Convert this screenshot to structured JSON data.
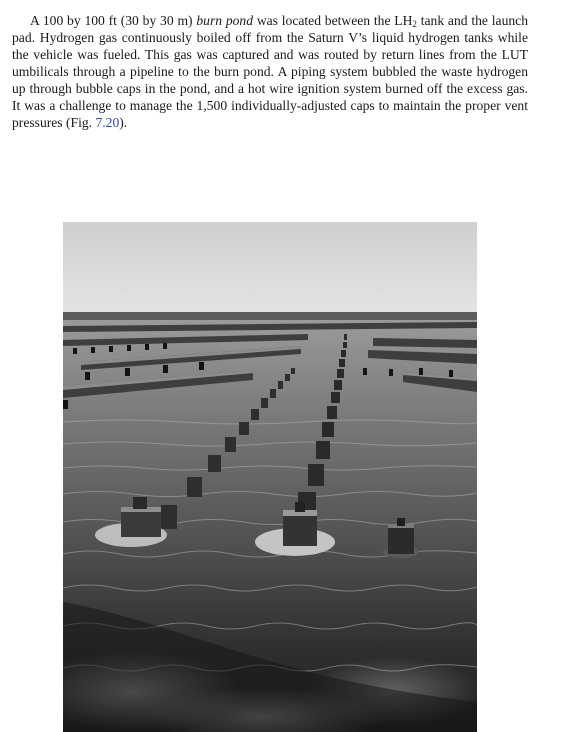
{
  "paragraph": {
    "s1_lead": "A 100 by 100 ft (30 by 30 m) ",
    "s1_term": "burn pond",
    "s1_rest_a": " was located between the LH",
    "s1_sub": "2",
    "s1_rest_b": " tank and the launch pad.",
    "s2": " Hydrogen gas continuously boiled off from the Saturn V’s liquid hydrogen tanks while the vehicle was fueled.",
    "s3": " This gas was captured and was routed by return lines from the LUT umbilicals through a pipeline to the burn pond.",
    "s4": " A piping system bubbled the waste hydrogen up through bubble caps in the pond, and a hot wire ignition system burned off the excess gas.",
    "s5_lead": " It was a challenge to manage the 1,500 individually-adjusted caps to maintain the proper vent pressures (Fig. ",
    "fig_ref": "7.20",
    "s5_tail": ")."
  },
  "figure": {
    "palette": {
      "sky": "#d9d9d9",
      "horizon": "#6f6f6f",
      "water_light": "#8a8a8a",
      "water_dark": "#1e1e1e",
      "cap": "#3a3a3a",
      "cap_highlight": "#bdbdbd",
      "foam": "#e6e6e6"
    }
  }
}
